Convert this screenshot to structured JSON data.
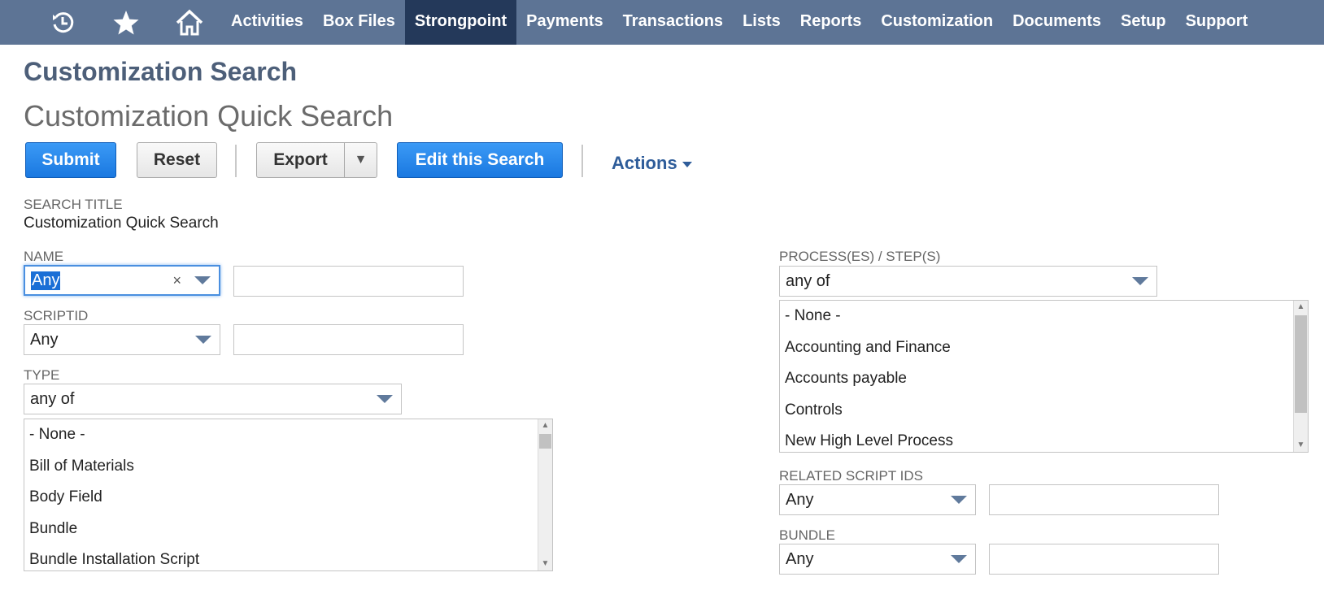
{
  "nav": {
    "icons": [
      "recent-icon",
      "star-icon",
      "home-icon"
    ],
    "items": [
      "Activities",
      "Box Files",
      "Strongpoint",
      "Payments",
      "Transactions",
      "Lists",
      "Reports",
      "Customization",
      "Documents",
      "Setup",
      "Support"
    ],
    "active": "Strongpoint"
  },
  "header": {
    "title": "Customization Search",
    "subtitle": "Customization Quick Search"
  },
  "toolbar": {
    "submit": "Submit",
    "reset": "Reset",
    "export": "Export",
    "export_arrow": "▼",
    "edit_search": "Edit this Search",
    "actions": "Actions"
  },
  "form": {
    "search_title": {
      "label": "SEARCH TITLE",
      "value": "Customization Quick Search"
    },
    "name": {
      "label": "NAME",
      "operator": "Any",
      "clear": "×",
      "value": ""
    },
    "scriptid": {
      "label": "SCRIPTID",
      "operator": "Any",
      "value": ""
    },
    "type": {
      "label": "TYPE",
      "operator": "any of",
      "options": [
        "- None -",
        "Bill of Materials",
        "Body Field",
        "Bundle",
        "Bundle Installation Script"
      ]
    },
    "processes": {
      "label": "PROCESS(ES) / STEP(S)",
      "operator": "any of",
      "options": [
        "- None -",
        "Accounting and Finance",
        "Accounts payable",
        "Controls",
        "New High Level Process"
      ]
    },
    "related_script_ids": {
      "label": "RELATED SCRIPT IDS",
      "operator": "Any",
      "value": ""
    },
    "bundle": {
      "label": "BUNDLE",
      "operator": "Any",
      "value": ""
    }
  },
  "colors": {
    "nav_bg": "#5d7495",
    "nav_active": "#24395a",
    "primary": "#1a78e0",
    "title": "#4d5f79",
    "link": "#2f5d9a"
  }
}
